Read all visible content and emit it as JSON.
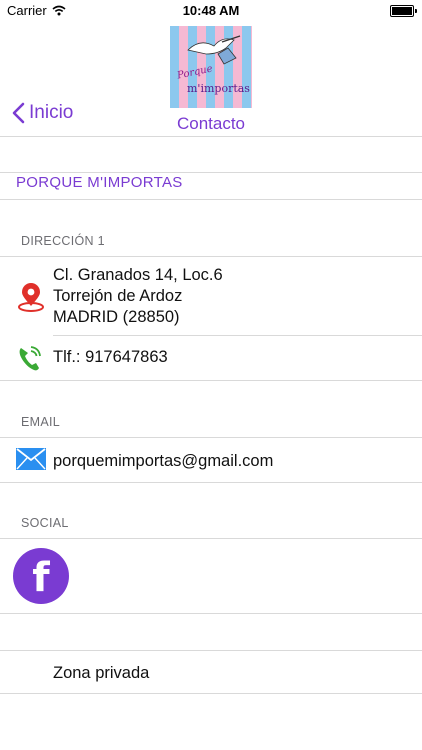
{
  "status_bar": {
    "carrier": "Carrier",
    "time": "10:48 AM"
  },
  "nav": {
    "back_label": "Inicio",
    "title": "Contacto",
    "logo_line1": "Porque",
    "logo_line2": "m'importas"
  },
  "company_name": "PORQUE M'IMPORTAS",
  "sections": {
    "address": {
      "header": "DIRECCIÓN 1",
      "lines": [
        "Cl. Granados 14, Loc.6",
        "Torrejón de Ardoz",
        "MADRID (28850)"
      ],
      "phone": "Tlf.: 917647863"
    },
    "email": {
      "header": "EMAIL",
      "address": "porquemimportas@gmail.com"
    },
    "social": {
      "header": "SOCIAL",
      "facebook_glyph": "f"
    }
  },
  "private_zone": "Zona privada",
  "colors": {
    "accent": "#7a3bd2",
    "separator": "#d9d9d9",
    "header_gray": "#6d6d72",
    "map_pin": "#e0302a",
    "phone_green": "#3aa935",
    "mail_blue": "#2a8ff0"
  },
  "icons": [
    "wifi-icon",
    "battery-icon",
    "back-chevron-icon",
    "map-pin-icon",
    "phone-icon",
    "mail-icon",
    "facebook-icon"
  ]
}
